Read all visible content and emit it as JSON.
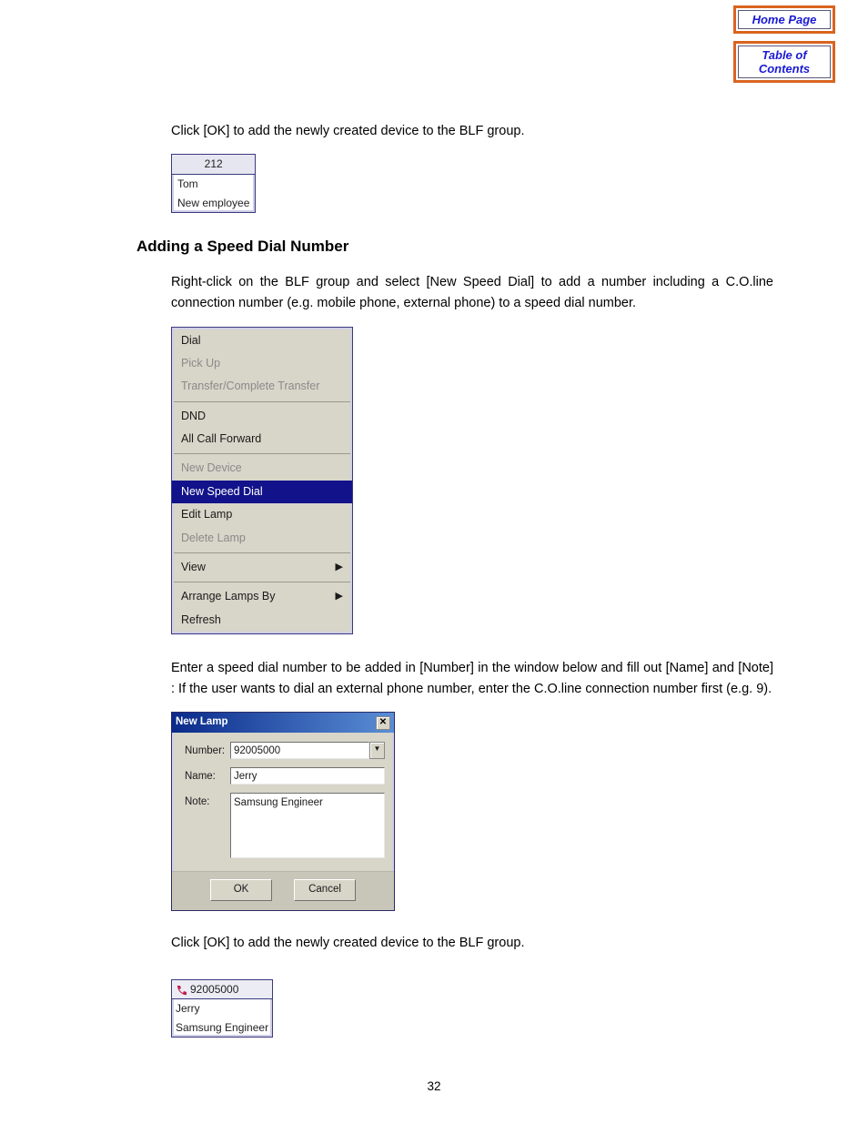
{
  "nav": {
    "home": "Home Page",
    "toc": "Table of Contents"
  },
  "body": {
    "p1": "Click [OK] to add the newly created device to the BLF group.",
    "card1": {
      "number": "212",
      "name": "Tom",
      "note": "New employee"
    },
    "heading": "Adding a Speed Dial Number",
    "p2": "Right-click on the BLF group and select [New Speed Dial] to add a number including a C.O.line connection number (e.g. mobile phone, external phone) to a speed dial number.",
    "menu": {
      "dial": "Dial",
      "pickup": "Pick Up",
      "transfer": "Transfer/Complete Transfer",
      "dnd": "DND",
      "all_call_fwd": "All Call Forward",
      "new_device": "New Device",
      "new_speed_dial": "New Speed Dial",
      "edit_lamp": "Edit Lamp",
      "delete_lamp": "Delete Lamp",
      "view": "View",
      "arrange_lamps_by": "Arrange Lamps By",
      "refresh": "Refresh"
    },
    "p3": "Enter a speed dial number to be added in [Number] in the window below and fill out [Name] and [Note] : If the user wants to dial an external phone number, enter the C.O.line connection number first (e.g. 9).",
    "dialog": {
      "title": "New Lamp",
      "labels": {
        "number": "Number:",
        "name": "Name:",
        "note": "Note:"
      },
      "values": {
        "number": "92005000",
        "name": "Jerry",
        "note": "Samsung Engineer"
      },
      "buttons": {
        "ok": "OK",
        "cancel": "Cancel"
      }
    },
    "p4": "Click [OK] to add the newly created device to the BLF group.",
    "card2": {
      "number": "92005000",
      "name": "Jerry",
      "note": "Samsung Engineer"
    }
  },
  "page_number": "32"
}
